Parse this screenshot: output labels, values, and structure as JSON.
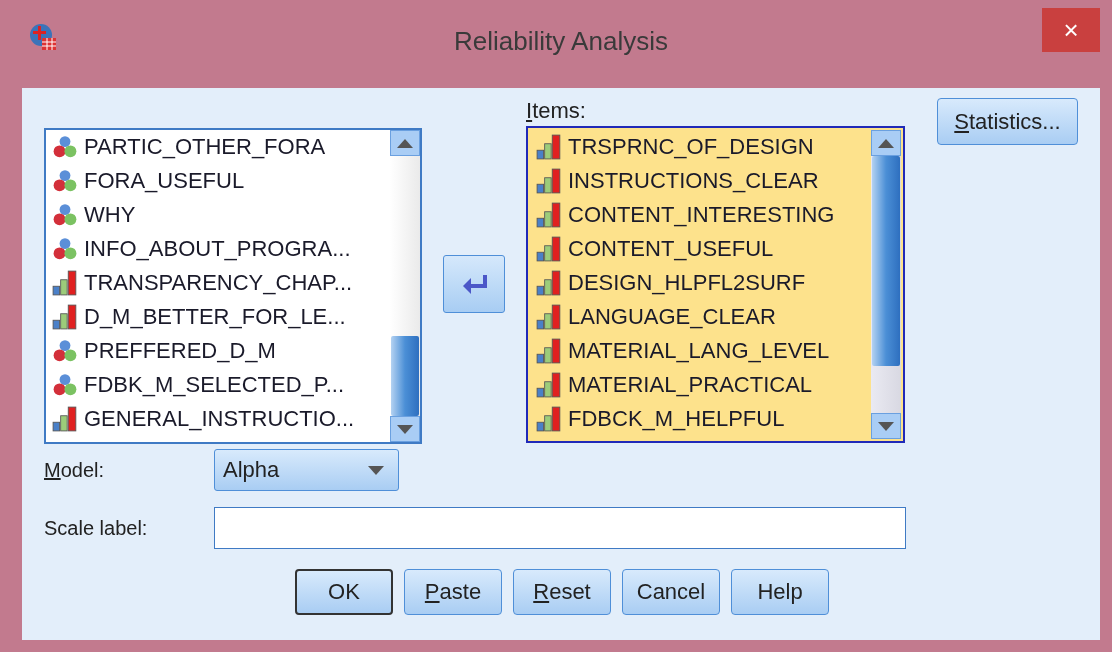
{
  "window": {
    "title": "Reliability Analysis",
    "close": "×"
  },
  "variables": [
    {
      "name": "PARTIC_OTHER_FORA",
      "kind": "nominal"
    },
    {
      "name": "FORA_USEFUL",
      "kind": "nominal"
    },
    {
      "name": "WHY",
      "kind": "nominal"
    },
    {
      "name": "INFO_ABOUT_PROGRA...",
      "kind": "nominal"
    },
    {
      "name": "TRANSPARENCY_CHAP...",
      "kind": "scale"
    },
    {
      "name": "D_M_BETTER_FOR_LE...",
      "kind": "scale"
    },
    {
      "name": "PREFFERED_D_M",
      "kind": "nominal"
    },
    {
      "name": "FDBK_M_SELECTED_P...",
      "kind": "nominal"
    },
    {
      "name": "GENERAL_INSTRUCTIO...",
      "kind": "scale"
    }
  ],
  "items": {
    "label": "Items:",
    "access_key_underlined": true,
    "rows": [
      {
        "name": "TRSPRNC_OF_DESIGN",
        "kind": "scale",
        "selected": true
      },
      {
        "name": "INSTRUCTIONS_CLEAR",
        "kind": "scale",
        "selected": true
      },
      {
        "name": "CONTENT_INTERESTING",
        "kind": "scale",
        "selected": true
      },
      {
        "name": "CONTENT_USEFUL",
        "kind": "scale",
        "selected": true
      },
      {
        "name": "DESIGN_HLPFL2SURF",
        "kind": "scale",
        "selected": true
      },
      {
        "name": "LANGUAGE_CLEAR",
        "kind": "scale",
        "selected": true
      },
      {
        "name": "MATERIAL_LANG_LEVEL",
        "kind": "scale",
        "selected": true
      },
      {
        "name": "MATERIAL_PRACTICAL",
        "kind": "scale",
        "selected": true
      },
      {
        "name": "FDBCK_M_HELPFUL",
        "kind": "scale",
        "selected": true
      }
    ]
  },
  "statistics_button": {
    "label": "Statistics...",
    "access_key_underlined": true
  },
  "model": {
    "label": "Model:",
    "access_key_underlined": true,
    "value": "Alpha"
  },
  "scale_label": {
    "label": "Scale label:"
  },
  "buttons": [
    {
      "label": "OK",
      "default": true,
      "access_key_underlined": false
    },
    {
      "label": "Paste",
      "access_key_underlined": true,
      "default": false
    },
    {
      "label": "Reset",
      "access_key_underlined": true,
      "default": false
    },
    {
      "label": "Cancel",
      "access_key_underlined": false,
      "default": false
    },
    {
      "label": "Help",
      "access_key_underlined": false,
      "default": false
    }
  ]
}
